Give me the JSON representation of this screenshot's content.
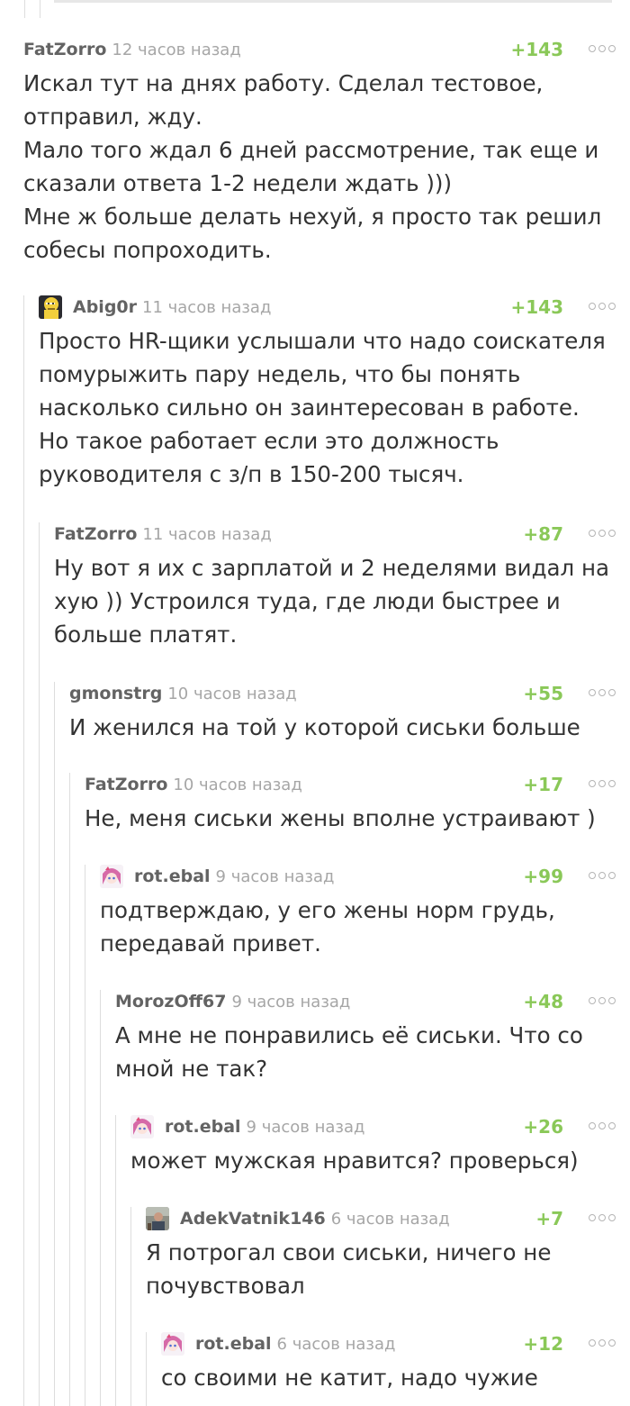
{
  "comments": [
    {
      "author": "FatZorro",
      "time": "12 часов назад",
      "score": "+143",
      "text": "Искал тут на днях работу. Сделал тестовое, отправил, жду.\nМало того ждал 6 дней рассмотрение, так еще и сказали ответа 1-2 недели ждать )))\nМне ж больше делать нехуй, я просто так решил собесы попроходить."
    },
    {
      "author": "Abig0r",
      "time": "11 часов назад",
      "score": "+143",
      "avatar": "bald-yellow-cartoon-avatar",
      "text": "Просто HR-щики услышали что надо соискателя помурыжить пару недель, что бы понять насколько сильно он заинтересован в работе. Но такое работает если это должность руководителя с з/п в 150-200 тысяч."
    },
    {
      "author": "FatZorro",
      "time": "11 часов назад",
      "score": "+87",
      "text": "Ну вот я их с зарплатой и 2 неделями видал на хую )) Устроился туда, где люди быстрее и больше платят."
    },
    {
      "author": "gmonstrg",
      "time": "10 часов назад",
      "score": "+55",
      "text": "И женился на той у которой сиськи больше"
    },
    {
      "author": "FatZorro",
      "time": "10 часов назад",
      "score": "+17",
      "text": "Не, меня сиськи жены вполне устраивают )"
    },
    {
      "author": "rot.ebal",
      "time": "9 часов назад",
      "score": "+99",
      "avatar": "anime-girl-avatar",
      "text": "подтверждаю, у его жены норм грудь, передавай привет."
    },
    {
      "author": "MorozOff67",
      "time": "9 часов назад",
      "score": "+48",
      "text": "А мне не понравились её сиськи. Что со мной не так?"
    },
    {
      "author": "rot.ebal",
      "time": "9 часов назад",
      "score": "+26",
      "avatar": "anime-girl-avatar",
      "text": "может мужская нравится? проверься)"
    },
    {
      "author": "AdekVatnik146",
      "time": "6 часов назад",
      "score": "+7",
      "avatar": "photo-person-avatar",
      "text": "Я потрогал свои сиськи, ничего не почувствовал"
    },
    {
      "author": "rot.ebal",
      "time": "6 часов назад",
      "score": "+12",
      "avatar": "anime-girl-avatar",
      "text": "со своими не катит, надо чужие"
    }
  ],
  "more_icon": "more-options-icon",
  "colors": {
    "score": "#8ac858",
    "author": "#636363",
    "time": "#a6a6a6",
    "text": "#333333",
    "thread_line": "#dddddd"
  }
}
